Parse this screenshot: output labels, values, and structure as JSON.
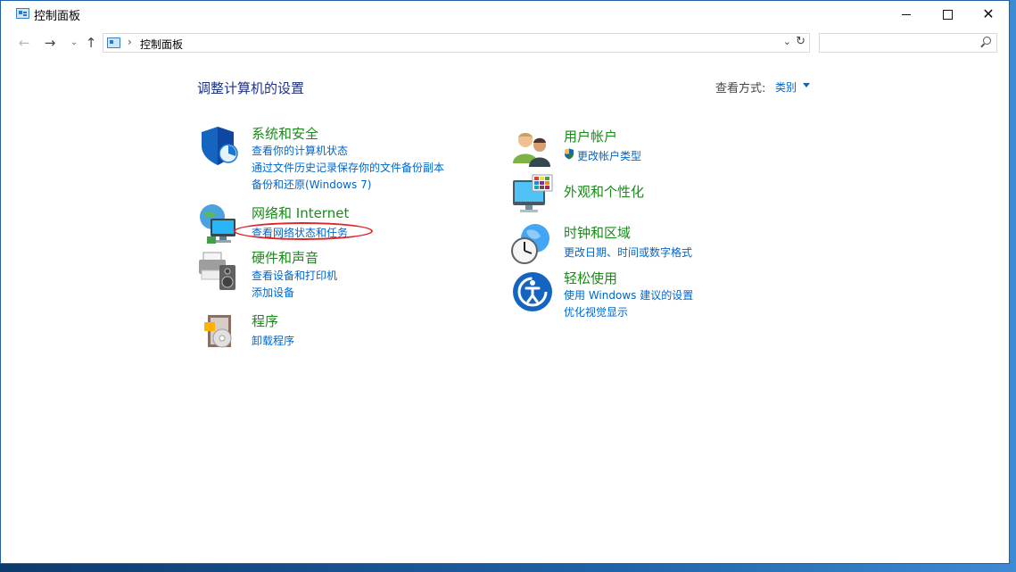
{
  "window": {
    "title": "控制面板"
  },
  "titlebar": {
    "close_glyph": "✕"
  },
  "nav": {
    "back_icon": "←",
    "forward_icon": "→",
    "recent_icon": "⌄",
    "up_icon": "↑",
    "separator": "›",
    "breadcrumb": "控制面板",
    "dropdown_icon": "⌄",
    "refresh_icon": "↻",
    "search_placeholder": ""
  },
  "main": {
    "heading": "调整计算机的设置",
    "view_by_label": "查看方式:",
    "view_by_value": "类别"
  },
  "categories": [
    {
      "title": "系统和安全",
      "links": [
        "查看你的计算机状态",
        "通过文件历史记录保存你的文件备份副本",
        "备份和还原(Windows 7)"
      ]
    },
    {
      "title": "网络和 Internet",
      "links": [
        "查看网络状态和任务"
      ]
    },
    {
      "title": "硬件和声音",
      "links": [
        "查看设备和打印机",
        "添加设备"
      ]
    },
    {
      "title": "程序",
      "links": [
        "卸载程序"
      ]
    },
    {
      "title": "用户帐户",
      "links": [
        "更改帐户类型"
      ]
    },
    {
      "title": "外观和个性化",
      "links": []
    },
    {
      "title": "时钟和区域",
      "links": [
        "更改日期、时间或数字格式"
      ]
    },
    {
      "title": "轻松使用",
      "links": [
        "使用 Windows 建议的设置",
        "优化视觉显示"
      ]
    }
  ],
  "colors": {
    "heading": "#1e3287",
    "category_title": "#1a8a1a",
    "link": "#0066cc",
    "annotation": "#e0262a",
    "desktop": "#1b4f86"
  },
  "icons": {
    "system_security": "shield-icon",
    "network": "globe-monitor-icon",
    "hardware_sound": "printer-speaker-icon",
    "programs": "program-disc-icon",
    "user_accounts": "users-icon",
    "appearance": "monitor-palette-icon",
    "clock_region": "clock-globe-icon",
    "ease_of_access": "ease-of-access-icon",
    "uac": "uac-shield-icon"
  }
}
